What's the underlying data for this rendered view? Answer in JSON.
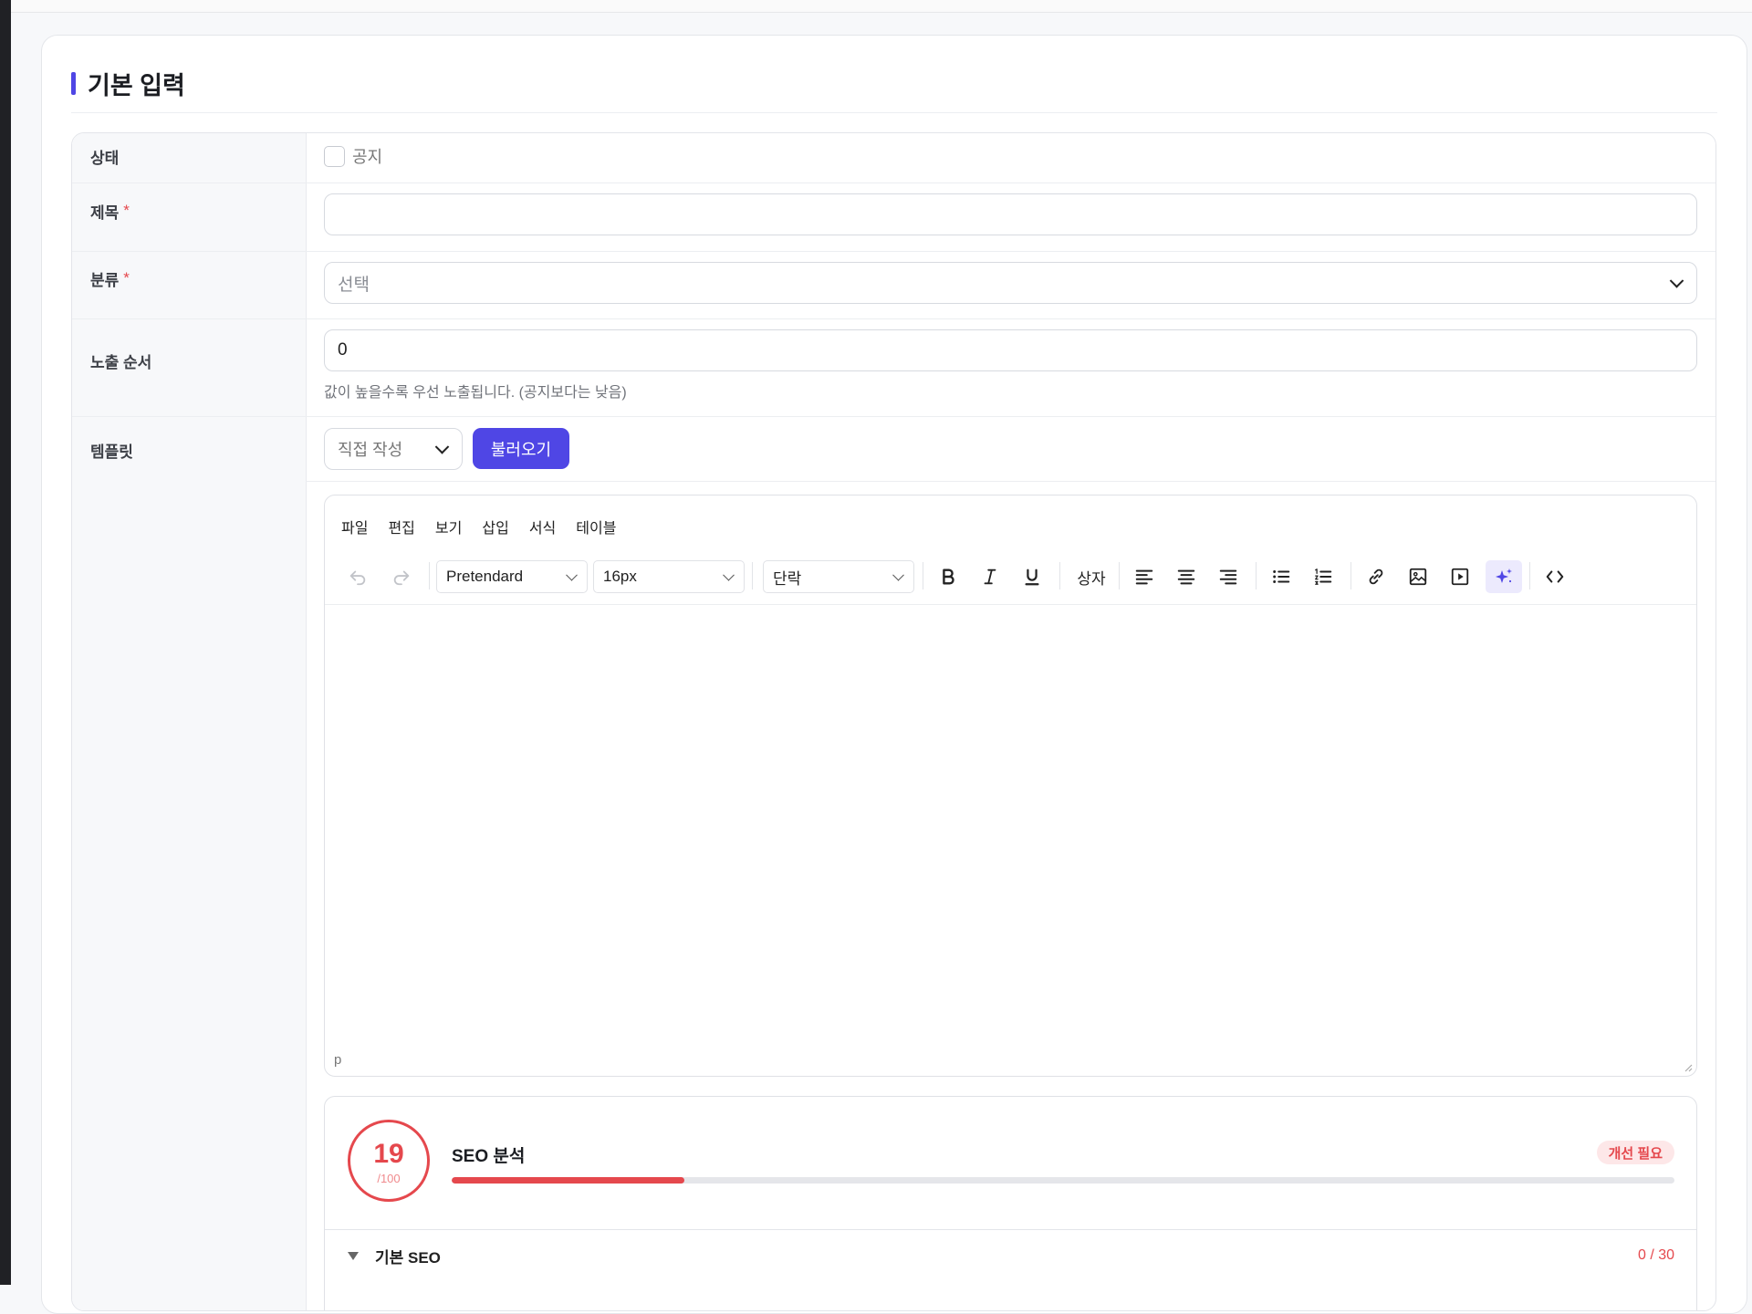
{
  "section": {
    "title": "기본 입력"
  },
  "form": {
    "status": {
      "label": "상태",
      "checkbox_label": "공지"
    },
    "title": {
      "label": "제목",
      "required_mark": "*",
      "value": ""
    },
    "category": {
      "label": "분류",
      "required_mark": "*",
      "placeholder": "선택"
    },
    "order": {
      "label": "노출 순서",
      "value": "0",
      "help": "값이 높을수록 우선 노출됩니다. (공지보다는 낮음)"
    },
    "template": {
      "label": "템플릿",
      "select_value": "직접 작성",
      "load_button": "불러오기"
    }
  },
  "editor": {
    "menu": [
      "파일",
      "편집",
      "보기",
      "삽입",
      "서식",
      "테이블"
    ],
    "font_family": "Pretendard",
    "font_size": "16px",
    "block_format": "단락",
    "box_label": "상자",
    "status_path": "p",
    "icons": [
      "undo-icon",
      "redo-icon",
      "bold-icon",
      "italic-icon",
      "underline-icon",
      "align-left-icon",
      "align-center-icon",
      "align-right-icon",
      "bullet-list-icon",
      "numbered-list-icon",
      "link-icon",
      "image-icon",
      "media-icon",
      "ai-sparkle-icon",
      "code-icon"
    ]
  },
  "seo": {
    "score": "19",
    "max": "/100",
    "score_fraction": 0.19,
    "title": "SEO 분석",
    "badge": "개선 필요",
    "section": "기본 SEO",
    "section_score": "0 / 30",
    "colors": {
      "accent": "#e5484d",
      "brand": "#4f46e5"
    }
  }
}
